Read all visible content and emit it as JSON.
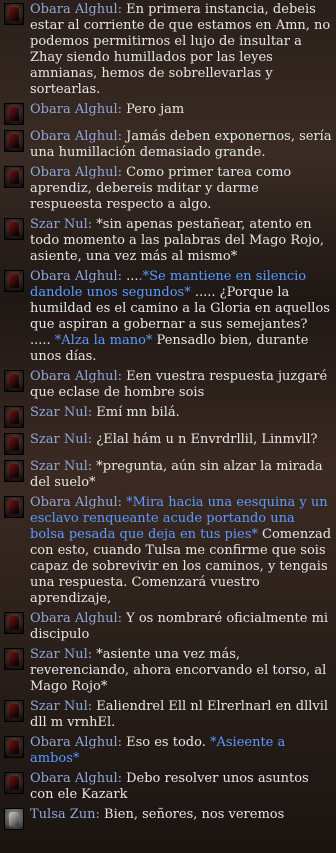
{
  "messages": [
    {
      "speaker": "Obara Alghul:",
      "avatar": "obara",
      "parts": [
        {
          "t": "text",
          "v": " En primera instancia, debeis estar al corriente de que estamos en Amn, no podemos permitirnos el lujo de insultar a Zhay siendo humillados por las leyes amnianas, hemos de sobrellevarlas y sortearlas."
        }
      ]
    },
    {
      "speaker": "Obara Alghul:",
      "avatar": "obara",
      "parts": [
        {
          "t": "text",
          "v": " Pero jam"
        }
      ]
    },
    {
      "speaker": "Obara Alghul:",
      "avatar": "obara",
      "parts": [
        {
          "t": "text",
          "v": " Jamás deben exponernos, sería una humillación demasiado grande."
        }
      ]
    },
    {
      "speaker": "Obara Alghul:",
      "avatar": "obara",
      "parts": [
        {
          "t": "text",
          "v": " Como primer tarea como aprendiz, debereis mditar y darme respueesta respecto a algo."
        }
      ]
    },
    {
      "speaker": "Szar Nul:",
      "avatar": "szar",
      "parts": [
        {
          "t": "text",
          "v": " *sin apenas pestañear, atento en todo momento a las palabras del Mago Rojo, asiente, una vez más al mismo*"
        }
      ]
    },
    {
      "speaker": "Obara Alghul:",
      "avatar": "obara",
      "parts": [
        {
          "t": "text",
          "v": " ..."
        },
        {
          "t": "emote",
          "v": ".*Se mantiene en silencio dandole unos segundos*"
        },
        {
          "t": "text",
          "v": " ..... ¿Porque la humildad es el camino a la Gloria en aquellos que aspiran a gobernar a sus semejantes? ..... "
        },
        {
          "t": "emote",
          "v": "*Alza la mano*"
        },
        {
          "t": "text",
          "v": " Pensadlo bien, durante unos días."
        }
      ]
    },
    {
      "speaker": "Obara Alghul:",
      "avatar": "obara",
      "parts": [
        {
          "t": "text",
          "v": " Een vuestra respuesta juzgaré que eclase de hombre sois"
        }
      ]
    },
    {
      "speaker": "Szar Nul:",
      "avatar": "szar",
      "parts": [
        {
          "t": "text",
          "v": " Emí mn bilá."
        }
      ]
    },
    {
      "speaker": "Szar Nul:",
      "avatar": "szar",
      "parts": [
        {
          "t": "text",
          "v": " ¿Elal hám u n Envrdrllil, Linmvll?"
        }
      ]
    },
    {
      "speaker": "Szar Nul:",
      "avatar": "szar",
      "parts": [
        {
          "t": "text",
          "v": " *pregunta, aún sin alzar la mirada del suelo*"
        }
      ]
    },
    {
      "speaker": "Obara Alghul:",
      "avatar": "obara",
      "parts": [
        {
          "t": "text",
          "v": " "
        },
        {
          "t": "emote",
          "v": "*Mira hacia una eesquina y un esclavo renqueante acude portando una bolsa pesada que deja en tus pies*"
        },
        {
          "t": "text",
          "v": " Comenzad con esto, cuando Tulsa me confirme que sois capaz de sobrevivir en los caminos, y tengais una respuesta. Comenzará vuestro aprendizaje,"
        }
      ]
    },
    {
      "speaker": "Obara Alghul:",
      "avatar": "obara",
      "parts": [
        {
          "t": "text",
          "v": " Y os nombraré oficialmente mi discipulo"
        }
      ]
    },
    {
      "speaker": "Szar Nul:",
      "avatar": "szar",
      "parts": [
        {
          "t": "text",
          "v": " *asiente una vez más, reverenciando, ahora encorvando el torso, al Mago Rojo*"
        }
      ]
    },
    {
      "speaker": "Szar Nul:",
      "avatar": "szar",
      "parts": [
        {
          "t": "text",
          "v": " Ealiendrel Ell nl Elrerlnarl en dllvil dll m  vrnhEl."
        }
      ]
    },
    {
      "speaker": "Obara Alghul:",
      "avatar": "obara",
      "parts": [
        {
          "t": "text",
          "v": " Eso es todo. "
        },
        {
          "t": "emote",
          "v": "*Asieente a ambos*"
        }
      ]
    },
    {
      "speaker": "Obara Alghul:",
      "avatar": "obara",
      "parts": [
        {
          "t": "text",
          "v": " Debo resolver unos asuntos con ele Kazark"
        }
      ]
    },
    {
      "speaker": "Tulsa Zun:",
      "avatar": "tulsa",
      "parts": [
        {
          "t": "text",
          "v": " Bien, señores, nos veremos"
        }
      ]
    }
  ],
  "colors": {
    "speaker": "#8fa6d8",
    "text": "#e6e6e6",
    "emote": "#5b9bff"
  }
}
